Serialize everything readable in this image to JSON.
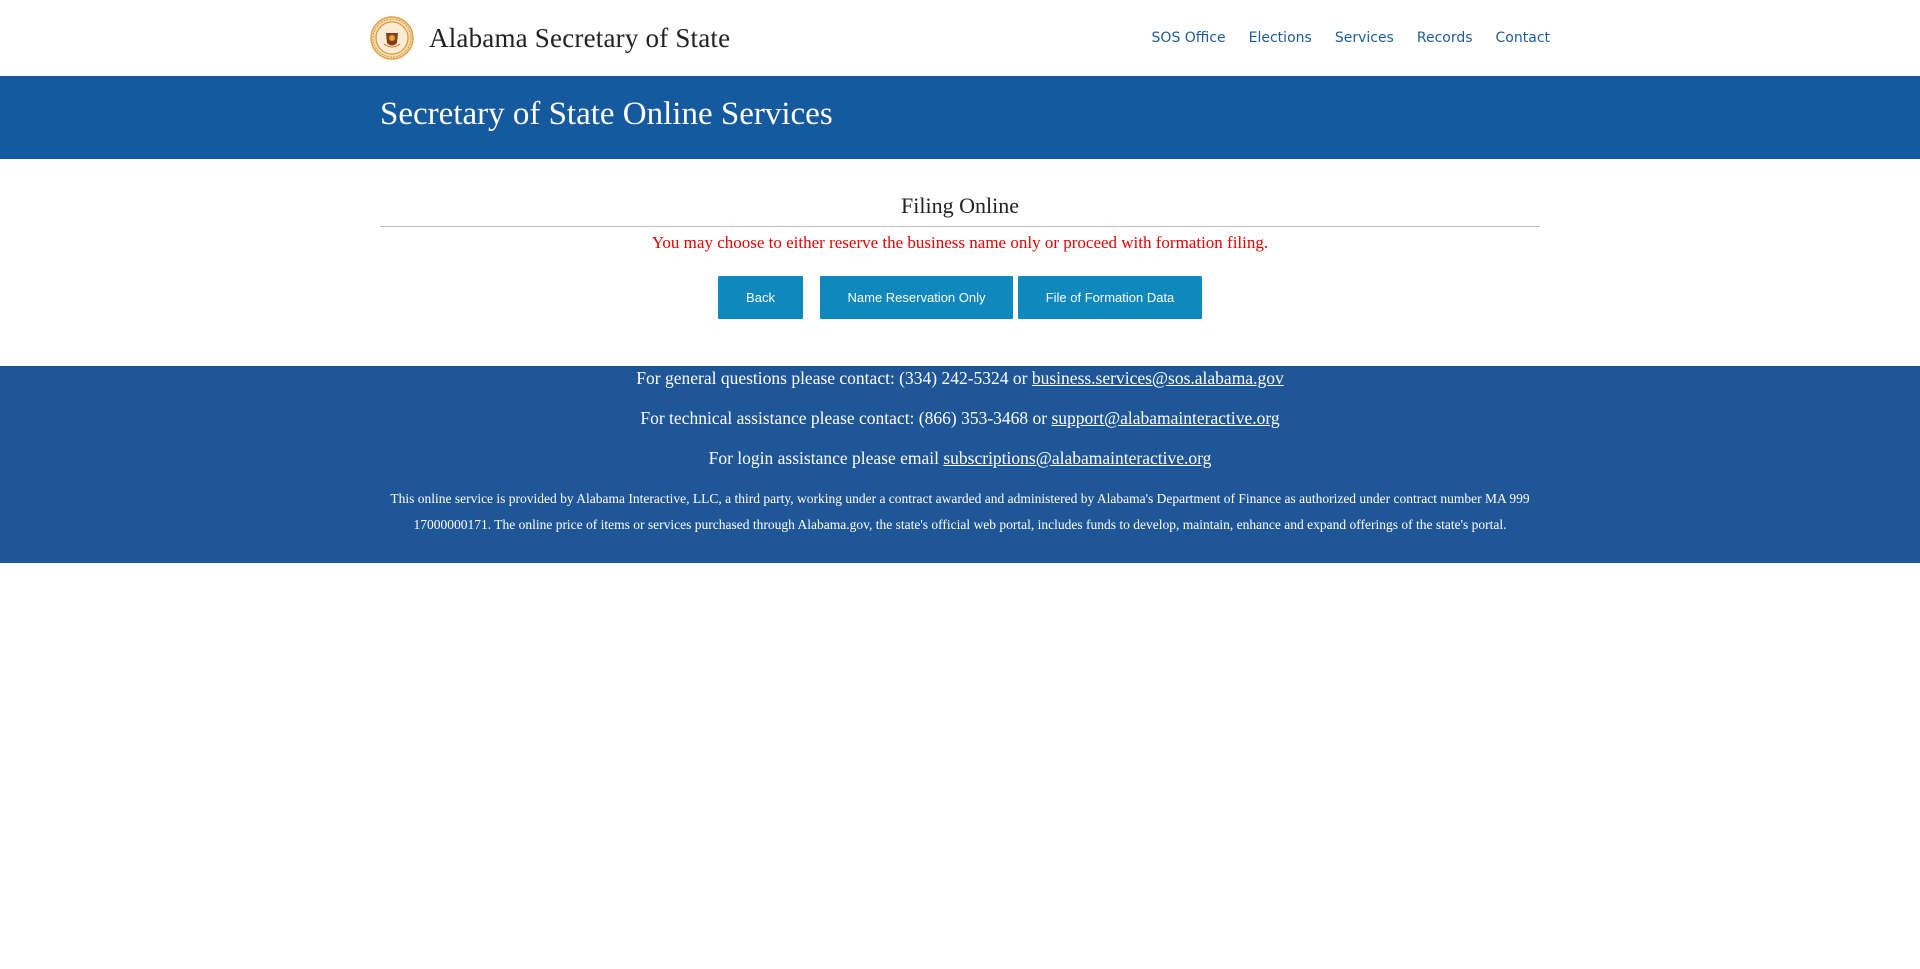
{
  "header": {
    "site_title": "Alabama Secretary of State",
    "logo": "state-seal-icon",
    "nav": [
      "SOS Office",
      "Elections",
      "Services",
      "Records",
      "Contact"
    ]
  },
  "banner": {
    "title": "Secretary of State Online Services"
  },
  "main": {
    "section_title": "Filing Online",
    "message": "You may choose to either reserve the business name only or proceed with formation filing.",
    "buttons": {
      "back": "Back",
      "name_reservation": "Name Reservation Only",
      "formation": "File of Formation Data"
    }
  },
  "footer": {
    "general_prefix": "For general questions please contact: (334) 242-5324 or ",
    "general_email": "business.services@sos.alabama.gov",
    "technical_prefix": "For technical assistance please contact: (866) 353-3468 or ",
    "technical_email": "support@alabamainteractive.org",
    "login_prefix": "For login assistance please email ",
    "login_email": "subscriptions@alabamainteractive.org",
    "disclaimer": "This online service is provided by Alabama Interactive, LLC, a third party, working under a contract awarded and administered by Alabama's Department of Finance as authorized under contract number MA 999 17000000171. The online price of items or services purchased through Alabama.gov, the state's official web portal, includes funds to develop, maintain, enhance and expand offerings of the state's portal."
  },
  "colors": {
    "banner": "#155a9e",
    "footer": "#1f5697",
    "button": "#0e88bd",
    "nav_link": "#1d5c9a",
    "alert_text": "#e60000"
  }
}
